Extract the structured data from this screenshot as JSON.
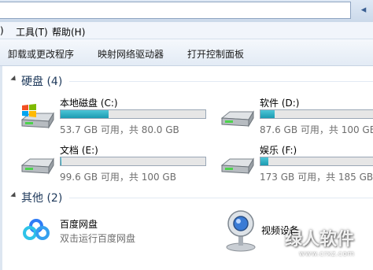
{
  "menu": {
    "tools_paren": ")",
    "tools": "工具(T)",
    "help": "帮助(H)"
  },
  "toolbar": {
    "uninstall": "卸载或更改程序",
    "map_drive": "映射网络驱动器",
    "control_panel": "打开控制面板"
  },
  "groups": {
    "hard_disks": "硬盘 (4)",
    "other": "其他 (2)"
  },
  "drives": [
    {
      "name": "本地磁盘 (C:)",
      "free_text": "53.7 GB 可用，共 80.0 GB",
      "used_fraction": 0.33,
      "icon": "windows-drive-icon"
    },
    {
      "name": "软件 (D:)",
      "free_text": "87.6 GB 可用，共 100 GB",
      "used_fraction": 0.12,
      "icon": "hard-drive-icon"
    },
    {
      "name": "文档 (E:)",
      "free_text": "99.6 GB 可用，共 100 GB",
      "used_fraction": 0.004,
      "icon": "hard-drive-icon"
    },
    {
      "name": "娱乐 (F:)",
      "free_text": "173 GB 可用，共 185 GB",
      "used_fraction": 0.065,
      "icon": "hard-drive-icon"
    }
  ],
  "others": [
    {
      "name": "百度网盘",
      "subtitle": "双击运行百度网盘",
      "icon": "baidu-netdisk-icon"
    },
    {
      "name": "视频设备",
      "icon": "webcam-icon"
    }
  ],
  "watermark": {
    "text": "绿人软件",
    "url": "www.crxz.com"
  },
  "colors": {
    "bar_fill": "#26a6bb",
    "group_title": "#1e395b"
  }
}
